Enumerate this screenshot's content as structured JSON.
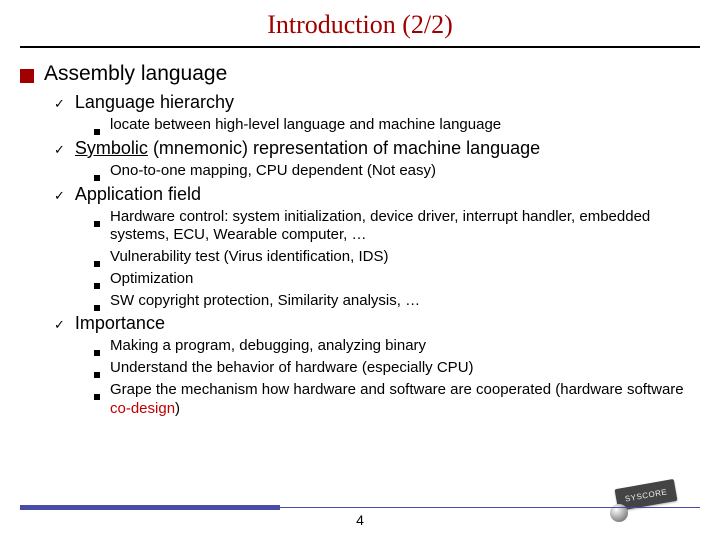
{
  "title": "Introduction (2/2)",
  "page_number": "4",
  "logo_text": "SYSCORE",
  "h1": {
    "text": "Assembly language"
  },
  "sec1": {
    "head": "Language hierarchy",
    "b1": "locate between high-level language and machine language"
  },
  "sec2": {
    "head_pre": "Symbolic",
    "head_post": " (mnemonic) representation of machine language",
    "b1": "Ono-to-one mapping, CPU dependent (Not easy)"
  },
  "sec3": {
    "head": "Application field",
    "b1": "Hardware control: system initialization, device driver, interrupt handler, embedded systems, ECU, Wearable computer, …",
    "b2": "Vulnerability test (Virus identification, IDS)",
    "b3": "Optimization",
    "b4": "SW copyright protection, Similarity analysis, …"
  },
  "sec4": {
    "head": "Importance",
    "b1": "Making a program, debugging, analyzing binary",
    "b2": "Understand the behavior of hardware (especially CPU)",
    "b3_pre": "Grape the mechanism how hardware and software are cooperated (hardware software ",
    "b3_red": "co-design",
    "b3_post": ")"
  }
}
